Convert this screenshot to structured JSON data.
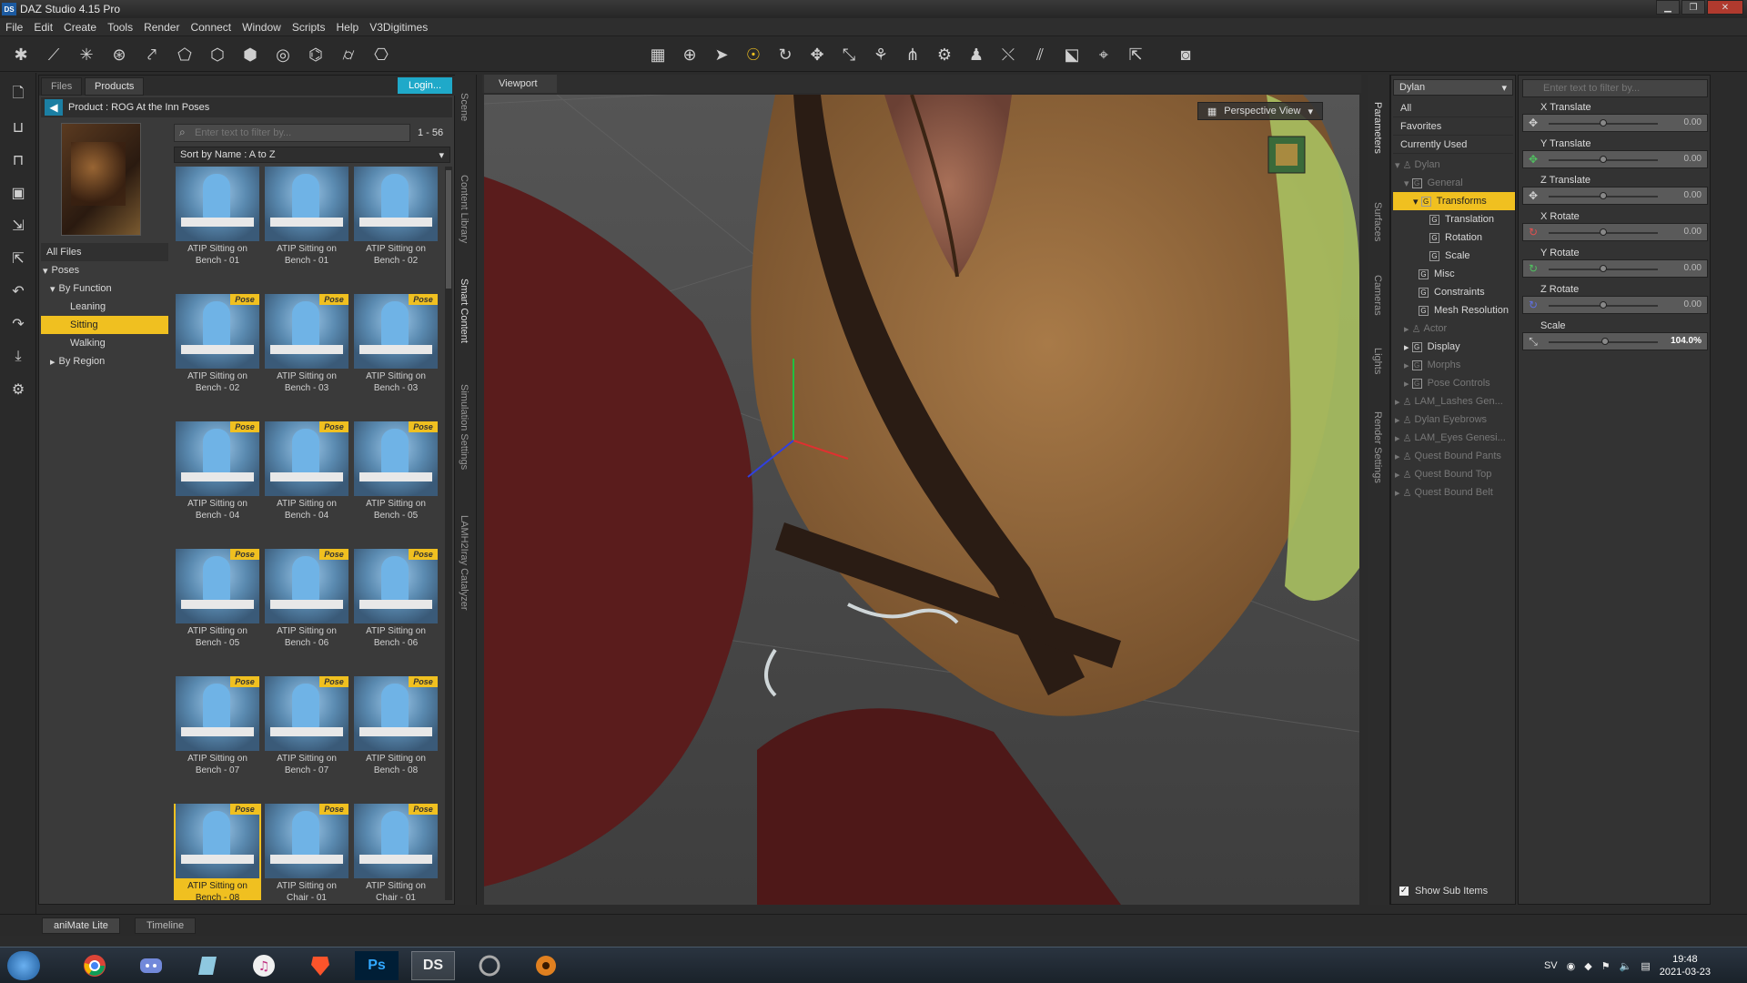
{
  "window": {
    "title": "DAZ Studio 4.15 Pro",
    "app_badge": "DS"
  },
  "menu": [
    "File",
    "Edit",
    "Create",
    "Tools",
    "Render",
    "Connect",
    "Window",
    "Scripts",
    "Help",
    "V3Digitimes"
  ],
  "content_library": {
    "tabs": [
      "Files",
      "Products"
    ],
    "login_label": "Login...",
    "product_title": "Product : ROG At the Inn Poses",
    "filter_placeholder": "Enter text to filter by...",
    "range": "1 - 56",
    "sort_label": "Sort by Name : A to Z",
    "tree": {
      "all_files": "All Files",
      "poses": "Poses",
      "by_function": "By Function",
      "leaning": "Leaning",
      "sitting": "Sitting",
      "walking": "Walking",
      "by_region": "By Region"
    },
    "badge": "Pose",
    "items": [
      {
        "l1": "ATIP Sitting on",
        "l2": "Bench - 01"
      },
      {
        "l1": "ATIP Sitting on",
        "l2": "Bench - 01"
      },
      {
        "l1": "ATIP Sitting on",
        "l2": "Bench - 02"
      },
      {
        "l1": "ATIP Sitting on",
        "l2": "Bench - 02"
      },
      {
        "l1": "ATIP Sitting on",
        "l2": "Bench - 03"
      },
      {
        "l1": "ATIP Sitting on",
        "l2": "Bench - 03"
      },
      {
        "l1": "ATIP Sitting on",
        "l2": "Bench - 04"
      },
      {
        "l1": "ATIP Sitting on",
        "l2": "Bench - 04"
      },
      {
        "l1": "ATIP Sitting on",
        "l2": "Bench - 05"
      },
      {
        "l1": "ATIP Sitting on",
        "l2": "Bench - 05"
      },
      {
        "l1": "ATIP Sitting on",
        "l2": "Bench - 06"
      },
      {
        "l1": "ATIP Sitting on",
        "l2": "Bench - 06"
      },
      {
        "l1": "ATIP Sitting on",
        "l2": "Bench - 07"
      },
      {
        "l1": "ATIP Sitting on",
        "l2": "Bench - 07"
      },
      {
        "l1": "ATIP Sitting on",
        "l2": "Bench - 08"
      },
      {
        "l1": "ATIP Sitting on",
        "l2": "Bench - 08"
      },
      {
        "l1": "ATIP Sitting on",
        "l2": "Chair - 01"
      },
      {
        "l1": "ATIP Sitting on",
        "l2": "Chair - 01"
      }
    ]
  },
  "side_tabs": [
    "Scene",
    "Content Library",
    "Smart Content",
    "Simulation Settings",
    "LAMH2Iray Catalyzer"
  ],
  "viewport": {
    "tab": "Viewport",
    "camera": "Perspective View"
  },
  "right_side_tabs": [
    "Parameters",
    "Surfaces",
    "Cameras",
    "Lights",
    "Render Settings"
  ],
  "scene_panel": {
    "figure": "Dylan",
    "filters": [
      "All",
      "Favorites",
      "Currently Used"
    ],
    "tree": {
      "dylan": "Dylan",
      "general": "General",
      "transforms": "Transforms",
      "translation": "Translation",
      "rotation": "Rotation",
      "scale": "Scale",
      "misc": "Misc",
      "constraints": "Constraints",
      "mesh_resolution": "Mesh Resolution",
      "actor": "Actor",
      "display": "Display",
      "morphs": "Morphs",
      "pose_controls": "Pose Controls",
      "lam_lashes": "LAM_Lashes Gen...",
      "eyebrows": "Dylan Eyebrows",
      "lam_eyes": "LAM_Eyes Genesi...",
      "quest_pants": "Quest Bound Pants",
      "quest_top": "Quest Bound Top",
      "quest_belt": "Quest Bound Belt"
    },
    "show_sub_items": "Show Sub Items"
  },
  "parameters": {
    "filter_placeholder": "Enter text to filter by...",
    "items": [
      {
        "name": "X Translate",
        "value": "0.00",
        "level": 0.5
      },
      {
        "name": "Y Translate",
        "value": "0.00",
        "level": 0.5
      },
      {
        "name": "Z Translate",
        "value": "0.00",
        "level": 0.5
      },
      {
        "name": "X Rotate",
        "value": "0.00",
        "level": 0.5
      },
      {
        "name": "Y Rotate",
        "value": "0.00",
        "level": 0.5
      },
      {
        "name": "Z Rotate",
        "value": "0.00",
        "level": 0.5
      },
      {
        "name": "Scale",
        "value": "104.0%",
        "level": 0.52
      }
    ]
  },
  "bottom_tabs": [
    "aniMate Lite",
    "Timeline"
  ],
  "taskbar": {
    "lang": "SV",
    "time": "19:48",
    "date": "2021-03-23",
    "apps": [
      "Ps",
      "DS"
    ]
  }
}
